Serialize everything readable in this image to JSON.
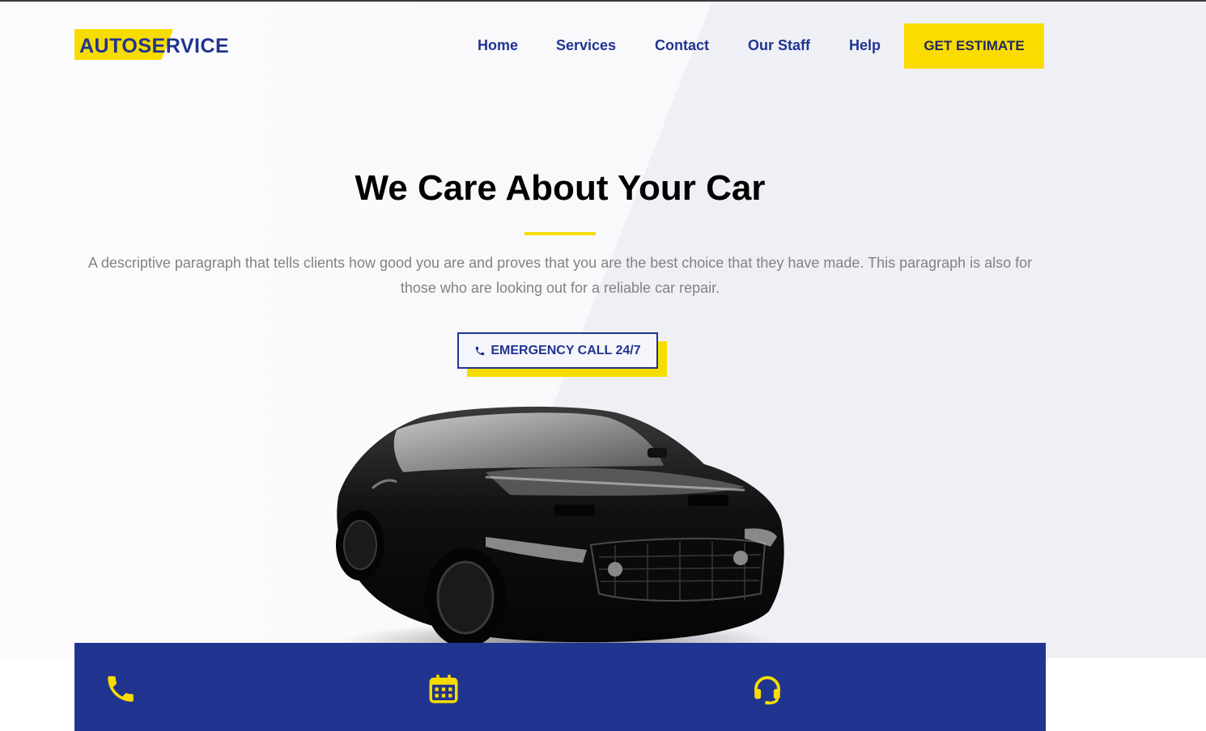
{
  "brand": {
    "logo_text": "AUTOSERVICE",
    "accent_color": "#f7dc00",
    "primary_color": "#21348f"
  },
  "nav": {
    "items": [
      {
        "label": "Home"
      },
      {
        "label": "Services"
      },
      {
        "label": "Contact"
      },
      {
        "label": "Our Staff"
      },
      {
        "label": "Help"
      }
    ],
    "cta_label": "GET ESTIMATE"
  },
  "hero": {
    "title": "We Care About Your Car",
    "description": "A descriptive paragraph that tells clients how good you are and proves that you are the best choice that they have made. This paragraph is also for those who are looking out for a reliable car repair.",
    "emergency_label": "EMERGENCY CALL 24/7",
    "emergency_icon": "phone-icon",
    "image": "black-sports-car"
  },
  "features": {
    "icons": [
      "phone-icon",
      "calendar-icon",
      "headset-icon"
    ],
    "icon_color": "#f7dc00",
    "background_color": "#21348f"
  }
}
